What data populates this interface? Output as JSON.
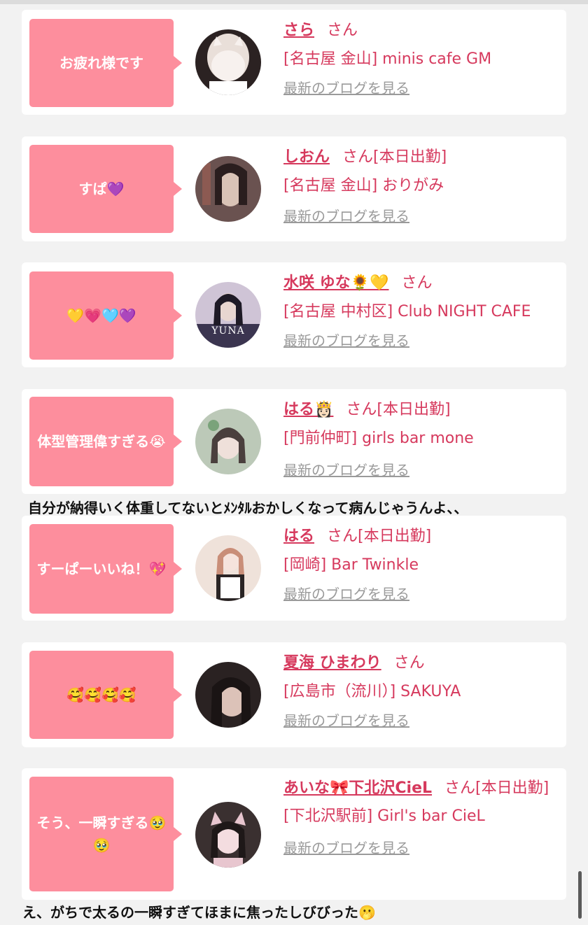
{
  "blog_link_label": "最新のブログを見る",
  "honorific": "さん",
  "items": [
    {
      "message": "お疲れ様です",
      "name": "さら",
      "status": "",
      "shop": "[名古屋 金山] minis cafe GM",
      "avatar_icon": "avatar-photo-cat-mask",
      "avatar_colors": [
        "#efe9e6",
        "#2b2222"
      ]
    },
    {
      "message": "すぱ💜",
      "name": "しおん",
      "status": "[本日出勤]",
      "shop": "[名古屋 金山] おりがみ",
      "avatar_icon": "avatar-photo",
      "avatar_colors": [
        "#6a5250",
        "#c9b4a8"
      ]
    },
    {
      "message": "💛💗🩵💜",
      "name": "水咲 ゆな🌻💛",
      "status": "",
      "shop": "[名古屋 中村区] Club NIGHT CAFE",
      "avatar_icon": "avatar-photo",
      "avatar_colors": [
        "#3b3550",
        "#cfc4d6"
      ],
      "avatar_label": "YUNA"
    },
    {
      "message": "体型管理偉すぎる😭",
      "name": "はる👸🏻",
      "status": "[本日出勤]",
      "shop": "[門前仲町] girls bar mone",
      "avatar_icon": "avatar-photo",
      "avatar_colors": [
        "#bcc9b8",
        "#6b6260"
      ]
    },
    {
      "message": "すーぱーいいね！💖",
      "name": "はる",
      "status": "[本日出勤]",
      "shop": "[岡崎] Bar Twinkle",
      "avatar_icon": "avatar-photo",
      "avatar_colors": [
        "#efe2da",
        "#b98a7c"
      ]
    },
    {
      "message": "🥰🥰🥰🥰",
      "name": "夏海 ひまわり",
      "status": "",
      "shop": "[広島市（流川）] SAKUYA",
      "avatar_icon": "avatar-photo",
      "avatar_colors": [
        "#2a2222",
        "#b99a8c"
      ]
    },
    {
      "message": "そう、一瞬すぎる🥹🥹",
      "name": "あいな🎀下北沢CieL",
      "status": "[本日出勤]",
      "shop": "[下北沢駅前] Girl's bar CieL",
      "avatar_icon": "avatar-photo",
      "avatar_colors": [
        "#3a3030",
        "#e8c6cf"
      ]
    }
  ],
  "captions": [
    "自分が納得いく体重してないとﾒﾝﾀﾙおかしくなって病んじゃうんよ、、",
    "え、がちで太るの一瞬すぎてほまに焦ったしびびった🫢"
  ],
  "colors": {
    "accent_pink": "#d6395d",
    "bubble_pink": "#fd8e9d",
    "link_gray": "#9a9a9a"
  }
}
